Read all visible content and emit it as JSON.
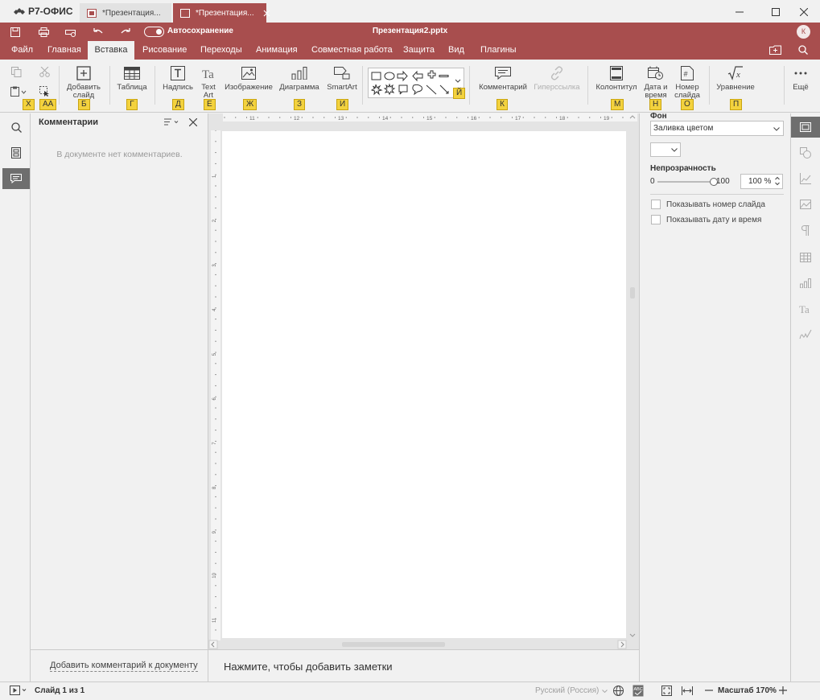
{
  "app": {
    "name": "Р7-ОФИС",
    "tabs": [
      {
        "label": "*Презентация..."
      },
      {
        "label": "*Презентация..."
      }
    ]
  },
  "quick_access": {
    "autosave_label": "Автосохранение",
    "doc_title": "Презентация2.pptx",
    "avatar_initial": "К"
  },
  "menu": {
    "tabs": [
      "Файл",
      "Главная",
      "Вставка",
      "Рисование",
      "Переходы",
      "Анимация",
      "Совместная работа",
      "Защита",
      "Вид",
      "Плагины"
    ],
    "active": "Вставка"
  },
  "ribbon": {
    "add_slide": "Добавить слайд",
    "table": "Таблица",
    "text_box": "Надпись",
    "text_art": "Text Art",
    "image": "Изображение",
    "chart": "Диаграмма",
    "smartart": "SmartArt",
    "comment": "Комментарий",
    "hyperlink": "Гиперссылка",
    "header_footer": "Колонтитул",
    "date_time": "Дата и время",
    "slide_number": "Номер слайда",
    "equation": "Уравнение",
    "more": "Ещё"
  },
  "hints": [
    "Х",
    "АА",
    "Б",
    "Г",
    "Д",
    "Е",
    "Ж",
    "З",
    "И",
    "Й",
    "К",
    "М",
    "Н",
    "О",
    "П"
  ],
  "comments_panel": {
    "title": "Комментарии",
    "empty_text": "В документе нет комментариев.",
    "add_link": "Добавить комментарий к документу"
  },
  "ruler": {
    "h_ticks": [
      "11",
      "12",
      "13",
      "14",
      "15",
      "16",
      "17",
      "18",
      "19"
    ],
    "v_ticks": [
      "1",
      "2",
      "3",
      "4",
      "5",
      "6",
      "7",
      "8",
      "9",
      "10",
      "11"
    ]
  },
  "notes": {
    "placeholder": "Нажмите, чтобы добавить заметки"
  },
  "right_panel": {
    "background_label": "Фон",
    "fill_type": "Заливка цветом",
    "opacity_label": "Непрозрачность",
    "opacity_min": "0",
    "opacity_max": "100",
    "opacity_value": "100 %",
    "opacity_fraction": 1.0,
    "show_slide_number": "Показывать номер слайда",
    "show_date_time": "Показывать дату и время"
  },
  "status": {
    "slide_info": "Слайд 1 из 1",
    "language": "Русский (Россия)",
    "zoom": "Масштаб 170%"
  },
  "colors": {
    "brand": "#a84e4e",
    "hint_bg": "#f3d23e",
    "panel_bg": "#f1f1f1"
  }
}
